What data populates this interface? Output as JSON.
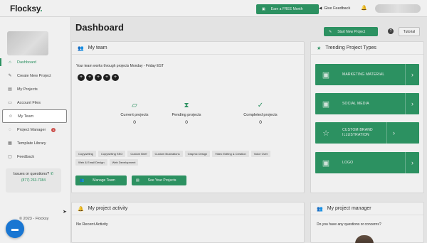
{
  "header": {
    "logo": "Flocksy",
    "logo_dot": ".",
    "earn_label": "Earn a FREE Month",
    "earn_icon": "gift-icon",
    "feedback_label": "Give Feedback",
    "feedback_icon": "megaphone-icon",
    "bell_icon": "bell-icon"
  },
  "sidebar": {
    "items": [
      {
        "label": "Dashboard",
        "icon": "home-icon",
        "active": true
      },
      {
        "label": "Create New Project",
        "icon": "edit-icon"
      },
      {
        "label": "My Projects",
        "icon": "clipboard-icon"
      },
      {
        "label": "Account Files",
        "icon": "folder-icon"
      },
      {
        "label": "My Team",
        "icon": "user-icon",
        "highlighted": true
      },
      {
        "label": "Project Manager",
        "icon": "chat-icon",
        "badge": "1"
      },
      {
        "label": "Template Library",
        "icon": "template-icon"
      },
      {
        "label": "Feedback",
        "icon": "feedback-icon"
      }
    ],
    "issues_question": "Issues or questions?",
    "issues_phone": "(877) 263-7384",
    "copyright": "© 2023 - Flocksy"
  },
  "main": {
    "title": "Dashboard",
    "start_project_label": "Start New Project",
    "help_label": "?",
    "tutorial_label": "Tutorial"
  },
  "team": {
    "title": "My team",
    "description": "Your team works through projects Monday - Friday EST",
    "stats": [
      {
        "label": "Current projects",
        "value": "0",
        "icon": "folder-open-icon"
      },
      {
        "label": "Pending projects",
        "value": "0",
        "icon": "hourglass-icon"
      },
      {
        "label": "Completed projects",
        "value": "0",
        "icon": "check-circle-icon"
      }
    ],
    "tags": [
      "Copywriting",
      "Copywriting SEO",
      "Custom Brief",
      "Custom Illustrations",
      "Graphic Design",
      "Video Editing & Creation",
      "Voice Over",
      "Web & Email Design",
      "Web Development"
    ],
    "manage_label": "Manage Team",
    "see_projects_label": "See Your Projects"
  },
  "trending": {
    "title": "Trending Project Types",
    "items": [
      {
        "label": "MARKETING MATERIAL",
        "icon": "image-icon"
      },
      {
        "label": "SOCIAL MEDIA",
        "icon": "image-icon"
      },
      {
        "label": "CUSTOM BRAND ILLUSTRATION",
        "icon": "star-icon"
      },
      {
        "label": "LOGO",
        "icon": "image-icon"
      }
    ]
  },
  "activity": {
    "title": "My project activity",
    "empty_text": "No Recent Activity"
  },
  "project_manager": {
    "title": "My project manager",
    "question": "Do you have any questions or concerns?"
  },
  "colors": {
    "accent": "#2f9b68",
    "chat_fab": "#1976d2",
    "badge": "#d9534f"
  }
}
